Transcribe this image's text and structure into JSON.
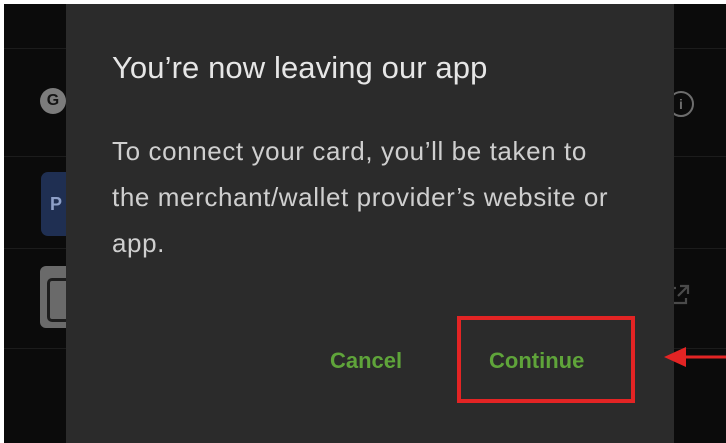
{
  "dialog": {
    "title": "You’re now leaving our app",
    "message": "To connect your card, you’ll be taken to the merchant/wallet provider’s website or app.",
    "cancel_label": "Cancel",
    "continue_label": "Continue"
  },
  "background": {
    "google_badge": "G",
    "paypal_badge": "P",
    "info_glyph": "i"
  },
  "colors": {
    "dialog_background": "#2b2b2b",
    "button_text": "#5fa43a",
    "highlight": "#e32424"
  },
  "icons": [
    "google-icon",
    "paypal-icon",
    "card-icon",
    "info-icon",
    "external-link-icon",
    "arrow-left-icon"
  ]
}
